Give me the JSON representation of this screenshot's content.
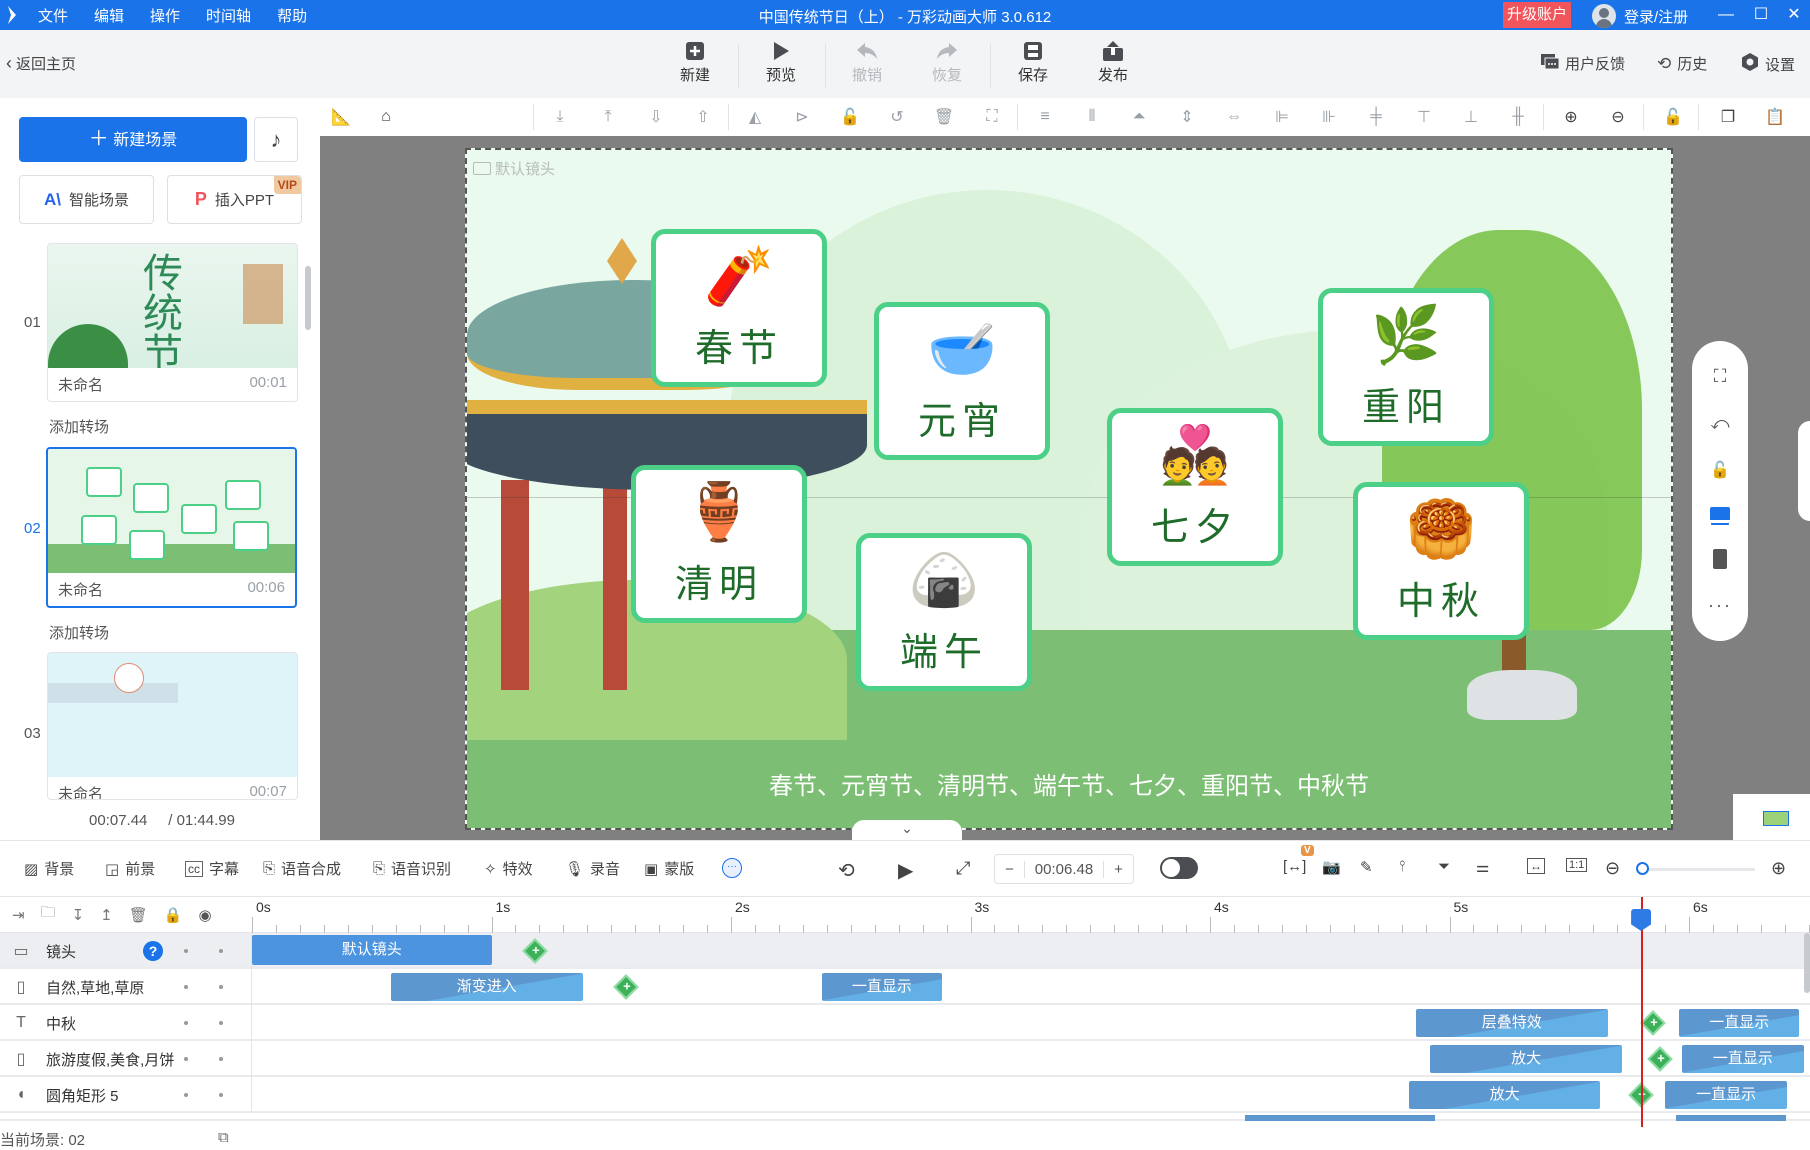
{
  "titlebar": {
    "menu": [
      "文件",
      "编辑",
      "操作",
      "时间轴",
      "帮助"
    ],
    "title": "中国传统节日（上） - 万彩动画大师 3.0.612",
    "upgrade": "升级账户",
    "login": "登录/注册",
    "colors": {
      "bar": "#1a73e8",
      "upgrade": "#f2545b"
    }
  },
  "toolbar": {
    "back": "返回主页",
    "buttons": [
      {
        "label": "新建",
        "icon": "plus-square-icon",
        "enabled": true
      },
      {
        "label": "预览",
        "icon": "play-icon",
        "enabled": true
      },
      {
        "label": "撤销",
        "icon": "undo-icon",
        "enabled": false
      },
      {
        "label": "恢复",
        "icon": "redo-icon",
        "enabled": false
      },
      {
        "label": "保存",
        "icon": "save-icon",
        "enabled": true
      },
      {
        "label": "发布",
        "icon": "publish-icon",
        "enabled": true
      }
    ],
    "right": [
      {
        "label": "用户反馈",
        "icon": "feedback-icon"
      },
      {
        "label": "历史",
        "icon": "history-icon"
      },
      {
        "label": "设置",
        "icon": "settings-icon"
      }
    ]
  },
  "leftpanel": {
    "new_scene": "新建场景",
    "smart_scene": "智能场景",
    "insert_ppt": "插入PPT",
    "vip": "VIP",
    "add_transition": "添加转场",
    "scenes": [
      {
        "num": "01",
        "name": "未命名",
        "time": "00:01",
        "selected": false,
        "thumb_title": "传统节日"
      },
      {
        "num": "02",
        "name": "未命名",
        "time": "00:06",
        "selected": true
      },
      {
        "num": "03",
        "name": "未命名",
        "time": "00:07",
        "selected": false
      }
    ],
    "current_time": "00:07.44",
    "total_time": "/ 01:44.99"
  },
  "canvas": {
    "camera_label": "默认镜头",
    "cards": [
      {
        "label": "春节",
        "art": "🧨"
      },
      {
        "label": "元宵",
        "art": "🥣"
      },
      {
        "label": "清明",
        "art": "🏺"
      },
      {
        "label": "端午",
        "art": "🍙"
      },
      {
        "label": "七夕",
        "art": "💑"
      },
      {
        "label": "重阳",
        "art": "🌿"
      },
      {
        "label": "中秋",
        "art": "🥮"
      }
    ],
    "caption": "春节、元宵节、清明节、端午节、七夕、重阳节、中秋节",
    "colors": {
      "card_border": "#4ccf86",
      "ground": "#7cbf74",
      "sky": "#eafaee"
    }
  },
  "timeline_toolbar": {
    "items": [
      {
        "label": "背景",
        "icon": "background-icon"
      },
      {
        "label": "前景",
        "icon": "foreground-icon"
      },
      {
        "label": "字幕",
        "icon": "subtitle-icon"
      },
      {
        "label": "语音合成",
        "icon": "tts-icon"
      },
      {
        "label": "语音识别",
        "icon": "speech-recognition-icon"
      },
      {
        "label": "特效",
        "icon": "effects-icon"
      },
      {
        "label": "录音",
        "icon": "microphone-icon"
      },
      {
        "label": "蒙版",
        "icon": "mask-icon"
      }
    ],
    "time": "00:06.48",
    "minus": "−",
    "plus": "+",
    "v_badge": "V"
  },
  "timeline": {
    "ruler": [
      "0s",
      "1s",
      "2s",
      "3s",
      "4s",
      "5s",
      "6s"
    ],
    "playhead_seconds": 5.8,
    "tracks": [
      {
        "name": "镜头",
        "icon": "camera-icon",
        "clips": [
          {
            "label": "默认镜头",
            "start": 0,
            "end": 1.0
          }
        ],
        "keyframes": [
          1.18
        ]
      },
      {
        "name": "自然,草地,草原",
        "icon": "svg-file-icon",
        "clips": [
          {
            "label": "渐变进入",
            "start": 0.58,
            "end": 1.38
          },
          {
            "label": "一直显示",
            "start": 2.38,
            "end": 2.88
          }
        ],
        "keyframes": [
          1.56
        ]
      },
      {
        "name": "中秋",
        "icon": "text-icon",
        "clips": [
          {
            "label": "层叠特效",
            "start": 4.86,
            "end": 5.66
          },
          {
            "label": "一直显示",
            "start": 5.96,
            "end": 6.46
          }
        ],
        "keyframes": [
          5.85
        ]
      },
      {
        "name": "旅游度假,美食,月饼",
        "icon": "svg-file-icon",
        "clips": [
          {
            "label": "放大",
            "start": 4.92,
            "end": 5.72
          },
          {
            "label": "一直显示",
            "start": 5.97,
            "end": 6.48
          }
        ],
        "keyframes": [
          5.88
        ]
      },
      {
        "name": "圆角矩形 5",
        "icon": "shape-icon",
        "clips": [
          {
            "label": "放大",
            "start": 4.83,
            "end": 5.63
          },
          {
            "label": "一直显示",
            "start": 5.9,
            "end": 6.41
          }
        ],
        "keyframes": [
          5.8
        ]
      }
    ],
    "current_scene": "当前场景: 02"
  }
}
